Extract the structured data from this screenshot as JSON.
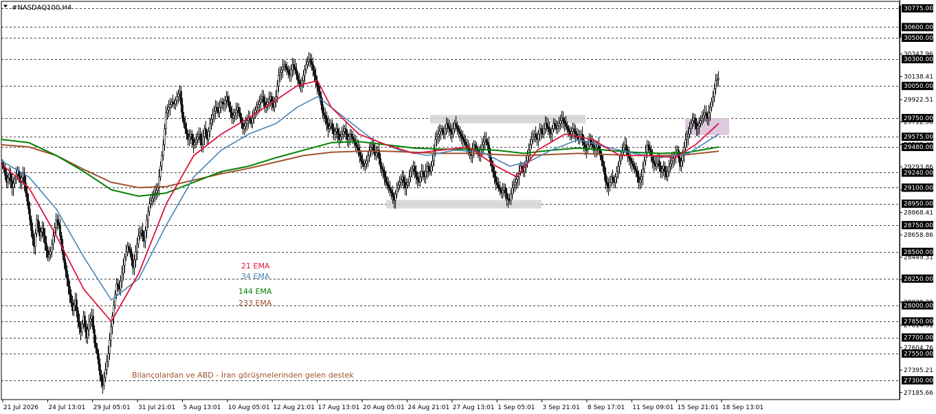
{
  "window": {
    "symbol_title": "#NASDAQ100,H4",
    "colors": {
      "background": "#ffffff",
      "grid": "#000000",
      "candle": "#000000",
      "price_label_bg": "#000000",
      "zone": "#d3d3d3",
      "zone_recent": "#d8bfd8"
    }
  },
  "chart_data": {
    "type": "candlestick",
    "title": "#NASDAQ100,H4",
    "ylim": [
      27120,
      30840
    ],
    "grid": true,
    "x_ticks": [
      "21 Jul 2026",
      "24 Jul 13:01",
      "29 Jul 05:01",
      "31 Jul 21:01",
      "5 Aug 13:01",
      "10 Aug 05:01",
      "12 Aug 21:01",
      "17 Aug 13:01",
      "20 Aug 05:01",
      "24 Aug 21:01",
      "27 Aug 13:01",
      "1 Sep 05:01",
      "3 Sep 21:01",
      "8 Sep 17:01",
      "11 Sep 09:01",
      "15 Sep 21:01",
      "18 Sep 13:01"
    ],
    "horizontal_levels": [
      30775.0,
      30600.0,
      30500.0,
      30300.0,
      30050.0,
      29750.0,
      29575.0,
      29480.0,
      29240.0,
      29100.0,
      28950.0,
      28750.0,
      28500.0,
      28250.0,
      28000.0,
      27850.0,
      27700.0,
      27550.0,
      27300.0
    ],
    "price_ticks": [
      "30347.96",
      "30138.41",
      "29922.51",
      "29712.96",
      "29503.41",
      "29293.86",
      "29077.96",
      "28868.41",
      "28658.86",
      "28449.31",
      "28239.76",
      "28030.21",
      "27814.31",
      "27604.76",
      "27395.21",
      "27185.66"
    ],
    "current_price": "30600.00",
    "series": [
      {
        "name": "21 EMA",
        "color": "#dc143c"
      },
      {
        "name": "34 EMA",
        "color": "#4682b4"
      },
      {
        "name": "144 EMA",
        "color": "#008000"
      },
      {
        "name": "233 EMA",
        "color": "#a0522d"
      }
    ],
    "candle_path": [
      [
        0,
        29330
      ],
      [
        4,
        29280
      ],
      [
        8,
        29150
      ],
      [
        12,
        29230
      ],
      [
        16,
        29100
      ],
      [
        20,
        29180
      ],
      [
        24,
        29260
      ],
      [
        28,
        29150
      ],
      [
        32,
        29240
      ],
      [
        36,
        29050
      ],
      [
        40,
        28900
      ],
      [
        44,
        28700
      ],
      [
        48,
        28550
      ],
      [
        52,
        28800
      ],
      [
        56,
        28650
      ],
      [
        60,
        28720
      ],
      [
        64,
        28580
      ],
      [
        68,
        28450
      ],
      [
        72,
        28500
      ],
      [
        76,
        28650
      ],
      [
        80,
        28800
      ],
      [
        84,
        28750
      ],
      [
        88,
        28550
      ],
      [
        92,
        28400
      ],
      [
        96,
        28250
      ],
      [
        100,
        28100
      ],
      [
        104,
        27950
      ],
      [
        108,
        28050
      ],
      [
        112,
        27850
      ],
      [
        116,
        27750
      ],
      [
        120,
        27900
      ],
      [
        124,
        27700
      ],
      [
        128,
        27850
      ],
      [
        132,
        27900
      ],
      [
        136,
        27650
      ],
      [
        140,
        27550
      ],
      [
        144,
        27350
      ],
      [
        148,
        27250
      ],
      [
        152,
        27400
      ],
      [
        156,
        27550
      ],
      [
        160,
        27800
      ],
      [
        164,
        28000
      ],
      [
        168,
        28200
      ],
      [
        172,
        28150
      ],
      [
        176,
        28300
      ],
      [
        180,
        28450
      ],
      [
        184,
        28550
      ],
      [
        188,
        28500
      ],
      [
        192,
        28350
      ],
      [
        196,
        28500
      ],
      [
        200,
        28650
      ],
      [
        204,
        28700
      ],
      [
        208,
        28600
      ],
      [
        212,
        28800
      ],
      [
        216,
        28950
      ],
      [
        220,
        29000
      ],
      [
        224,
        29050
      ],
      [
        228,
        29100
      ],
      [
        232,
        29300
      ],
      [
        236,
        29500
      ],
      [
        240,
        29800
      ],
      [
        244,
        29850
      ],
      [
        248,
        29900
      ],
      [
        252,
        29880
      ],
      [
        256,
        29950
      ],
      [
        260,
        30000
      ],
      [
        264,
        29750
      ],
      [
        268,
        29650
      ],
      [
        272,
        29550
      ],
      [
        276,
        29600
      ],
      [
        280,
        29500
      ],
      [
        284,
        29550
      ],
      [
        288,
        29600
      ],
      [
        292,
        29500
      ],
      [
        296,
        29650
      ],
      [
        300,
        29550
      ],
      [
        304,
        29700
      ],
      [
        308,
        29780
      ],
      [
        312,
        29850
      ],
      [
        316,
        29800
      ],
      [
        320,
        29900
      ],
      [
        324,
        29880
      ],
      [
        328,
        29950
      ],
      [
        332,
        29850
      ],
      [
        336,
        29750
      ],
      [
        340,
        29800
      ],
      [
        344,
        29850
      ],
      [
        348,
        29750
      ],
      [
        352,
        29650
      ],
      [
        356,
        29700
      ],
      [
        360,
        29750
      ],
      [
        364,
        29700
      ],
      [
        368,
        29800
      ],
      [
        372,
        29850
      ],
      [
        376,
        29900
      ],
      [
        380,
        29950
      ],
      [
        384,
        29850
      ],
      [
        388,
        29900
      ],
      [
        392,
        29950
      ],
      [
        396,
        29850
      ],
      [
        400,
        29950
      ],
      [
        404,
        30150
      ],
      [
        408,
        30200
      ],
      [
        412,
        30250
      ],
      [
        416,
        30200
      ],
      [
        420,
        30150
      ],
      [
        424,
        30250
      ],
      [
        428,
        30200
      ],
      [
        432,
        30100
      ],
      [
        436,
        30050
      ],
      [
        440,
        30150
      ],
      [
        444,
        30250
      ],
      [
        448,
        30300
      ],
      [
        452,
        30250
      ],
      [
        456,
        30150
      ],
      [
        460,
        30050
      ],
      [
        464,
        29950
      ],
      [
        468,
        29800
      ],
      [
        472,
        29750
      ],
      [
        476,
        29650
      ],
      [
        480,
        29700
      ],
      [
        484,
        29600
      ],
      [
        488,
        29650
      ],
      [
        492,
        29550
      ],
      [
        496,
        29600
      ],
      [
        500,
        29650
      ],
      [
        504,
        29550
      ],
      [
        508,
        29600
      ],
      [
        512,
        29550
      ],
      [
        516,
        29500
      ],
      [
        520,
        29450
      ],
      [
        524,
        29350
      ],
      [
        528,
        29300
      ],
      [
        532,
        29350
      ],
      [
        536,
        29450
      ],
      [
        540,
        29500
      ],
      [
        544,
        29400
      ],
      [
        548,
        29450
      ],
      [
        552,
        29300
      ],
      [
        556,
        29250
      ],
      [
        560,
        29150
      ],
      [
        564,
        29100
      ],
      [
        568,
        29050
      ],
      [
        572,
        28980
      ],
      [
        576,
        29100
      ],
      [
        580,
        29150
      ],
      [
        584,
        29200
      ],
      [
        588,
        29100
      ],
      [
        592,
        29150
      ],
      [
        596,
        29250
      ],
      [
        600,
        29300
      ],
      [
        604,
        29200
      ],
      [
        608,
        29150
      ],
      [
        612,
        29250
      ],
      [
        616,
        29200
      ],
      [
        620,
        29300
      ],
      [
        624,
        29250
      ],
      [
        628,
        29350
      ],
      [
        632,
        29550
      ],
      [
        636,
        29600
      ],
      [
        640,
        29650
      ],
      [
        644,
        29600
      ],
      [
        648,
        29700
      ],
      [
        652,
        29650
      ],
      [
        656,
        29600
      ],
      [
        660,
        29700
      ],
      [
        664,
        29650
      ],
      [
        668,
        29600
      ],
      [
        672,
        29550
      ],
      [
        676,
        29500
      ],
      [
        680,
        29450
      ],
      [
        684,
        29400
      ],
      [
        688,
        29500
      ],
      [
        692,
        29450
      ],
      [
        696,
        29400
      ],
      [
        700,
        29500
      ],
      [
        704,
        29550
      ],
      [
        708,
        29500
      ],
      [
        712,
        29350
      ],
      [
        716,
        29250
      ],
      [
        720,
        29150
      ],
      [
        724,
        29100
      ],
      [
        728,
        29050
      ],
      [
        732,
        29100
      ],
      [
        736,
        29000
      ],
      [
        740,
        28980
      ],
      [
        744,
        29100
      ],
      [
        748,
        29150
      ],
      [
        752,
        29200
      ],
      [
        756,
        29300
      ],
      [
        760,
        29250
      ],
      [
        764,
        29350
      ],
      [
        768,
        29450
      ],
      [
        772,
        29550
      ],
      [
        776,
        29600
      ],
      [
        780,
        29550
      ],
      [
        784,
        29650
      ],
      [
        788,
        29600
      ],
      [
        792,
        29700
      ],
      [
        796,
        29650
      ],
      [
        800,
        29600
      ],
      [
        804,
        29700
      ],
      [
        808,
        29650
      ],
      [
        812,
        29700
      ],
      [
        816,
        29750
      ],
      [
        820,
        29700
      ],
      [
        824,
        29650
      ],
      [
        828,
        29600
      ],
      [
        832,
        29650
      ],
      [
        836,
        29600
      ],
      [
        840,
        29550
      ],
      [
        844,
        29600
      ],
      [
        848,
        29500
      ],
      [
        852,
        29450
      ],
      [
        856,
        29550
      ],
      [
        860,
        29500
      ],
      [
        864,
        29450
      ],
      [
        868,
        29500
      ],
      [
        872,
        29400
      ],
      [
        876,
        29300
      ],
      [
        880,
        29150
      ],
      [
        884,
        29100
      ],
      [
        888,
        29200
      ],
      [
        892,
        29150
      ],
      [
        896,
        29250
      ],
      [
        900,
        29350
      ],
      [
        904,
        29450
      ],
      [
        908,
        29500
      ],
      [
        912,
        29400
      ],
      [
        916,
        29350
      ],
      [
        920,
        29300
      ],
      [
        924,
        29250
      ],
      [
        928,
        29150
      ],
      [
        932,
        29200
      ],
      [
        936,
        29350
      ],
      [
        940,
        29500
      ],
      [
        944,
        29450
      ],
      [
        948,
        29350
      ],
      [
        952,
        29300
      ],
      [
        956,
        29350
      ],
      [
        960,
        29250
      ],
      [
        964,
        29300
      ],
      [
        968,
        29200
      ],
      [
        972,
        29300
      ],
      [
        976,
        29350
      ],
      [
        980,
        29400
      ],
      [
        984,
        29450
      ],
      [
        988,
        29300
      ],
      [
        992,
        29400
      ],
      [
        996,
        29550
      ],
      [
        1000,
        29600
      ],
      [
        1004,
        29700
      ],
      [
        1008,
        29750
      ],
      [
        1012,
        29650
      ],
      [
        1016,
        29700
      ],
      [
        1020,
        29750
      ],
      [
        1024,
        29800
      ],
      [
        1028,
        29750
      ],
      [
        1032,
        29850
      ],
      [
        1036,
        29950
      ],
      [
        1040,
        30100
      ],
      [
        1044,
        30120
      ]
    ],
    "ema21": [
      [
        0,
        29320
      ],
      [
        40,
        29100
      ],
      [
        80,
        28650
      ],
      [
        120,
        28150
      ],
      [
        160,
        27850
      ],
      [
        200,
        28300
      ],
      [
        240,
        28950
      ],
      [
        280,
        29400
      ],
      [
        320,
        29600
      ],
      [
        360,
        29750
      ],
      [
        400,
        29920
      ],
      [
        430,
        30050
      ],
      [
        460,
        30100
      ],
      [
        480,
        29850
      ],
      [
        520,
        29600
      ],
      [
        560,
        29500
      ],
      [
        600,
        29420
      ],
      [
        640,
        29450
      ],
      [
        680,
        29480
      ],
      [
        720,
        29300
      ],
      [
        750,
        29200
      ],
      [
        780,
        29450
      ],
      [
        820,
        29600
      ],
      [
        860,
        29550
      ],
      [
        900,
        29400
      ],
      [
        940,
        29400
      ],
      [
        980,
        29380
      ],
      [
        1010,
        29500
      ],
      [
        1044,
        29700
      ]
    ],
    "ema34": [
      [
        0,
        29350
      ],
      [
        40,
        29200
      ],
      [
        80,
        28900
      ],
      [
        120,
        28450
      ],
      [
        160,
        28050
      ],
      [
        200,
        28250
      ],
      [
        240,
        28750
      ],
      [
        280,
        29200
      ],
      [
        320,
        29450
      ],
      [
        360,
        29600
      ],
      [
        400,
        29700
      ],
      [
        430,
        29850
      ],
      [
        460,
        29950
      ],
      [
        500,
        29750
      ],
      [
        540,
        29550
      ],
      [
        580,
        29450
      ],
      [
        620,
        29400
      ],
      [
        660,
        29450
      ],
      [
        700,
        29430
      ],
      [
        740,
        29300
      ],
      [
        770,
        29350
      ],
      [
        800,
        29450
      ],
      [
        840,
        29550
      ],
      [
        880,
        29480
      ],
      [
        920,
        29420
      ],
      [
        960,
        29380
      ],
      [
        1000,
        29420
      ],
      [
        1044,
        29600
      ]
    ],
    "ema144": [
      [
        0,
        29550
      ],
      [
        40,
        29520
      ],
      [
        80,
        29400
      ],
      [
        120,
        29250
      ],
      [
        160,
        29080
      ],
      [
        200,
        29020
      ],
      [
        240,
        29050
      ],
      [
        280,
        29150
      ],
      [
        320,
        29250
      ],
      [
        360,
        29300
      ],
      [
        400,
        29380
      ],
      [
        440,
        29450
      ],
      [
        480,
        29520
      ],
      [
        520,
        29530
      ],
      [
        560,
        29500
      ],
      [
        600,
        29470
      ],
      [
        640,
        29460
      ],
      [
        680,
        29460
      ],
      [
        720,
        29450
      ],
      [
        760,
        29420
      ],
      [
        800,
        29450
      ],
      [
        840,
        29470
      ],
      [
        880,
        29450
      ],
      [
        920,
        29430
      ],
      [
        960,
        29420
      ],
      [
        1000,
        29430
      ],
      [
        1044,
        29480
      ]
    ],
    "ema233": [
      [
        0,
        29500
      ],
      [
        40,
        29480
      ],
      [
        80,
        29400
      ],
      [
        120,
        29270
      ],
      [
        160,
        29150
      ],
      [
        200,
        29100
      ],
      [
        240,
        29110
      ],
      [
        280,
        29170
      ],
      [
        320,
        29230
      ],
      [
        360,
        29280
      ],
      [
        400,
        29340
      ],
      [
        440,
        29400
      ],
      [
        480,
        29430
      ],
      [
        520,
        29440
      ],
      [
        560,
        29440
      ],
      [
        600,
        29430
      ],
      [
        640,
        29420
      ],
      [
        680,
        29420
      ],
      [
        720,
        29410
      ],
      [
        760,
        29400
      ],
      [
        800,
        29410
      ],
      [
        840,
        29420
      ],
      [
        880,
        29410
      ],
      [
        920,
        29400
      ],
      [
        960,
        29400
      ],
      [
        1000,
        29410
      ],
      [
        1044,
        29440
      ]
    ],
    "zones": [
      {
        "x0": 624,
        "x1": 850,
        "y0": 29780,
        "y1": 29700
      },
      {
        "x0": 560,
        "x1": 786,
        "y0": 28985,
        "y1": 28905
      },
      {
        "x0": 995,
        "x1": 1059,
        "y0": 29750,
        "y1": 29590
      }
    ]
  },
  "annotations": {
    "legend": [
      {
        "text": "21 EMA",
        "color": "#dc143c"
      },
      {
        "text": "34 EMA",
        "color": "#4682b4"
      },
      {
        "text": "144 EMA",
        "color": "#008000"
      },
      {
        "text": "233 EMA",
        "color": "#a0522d"
      }
    ],
    "note": "Bilançolardan ve ABD - İran görüşmelerinden gelen destek"
  }
}
